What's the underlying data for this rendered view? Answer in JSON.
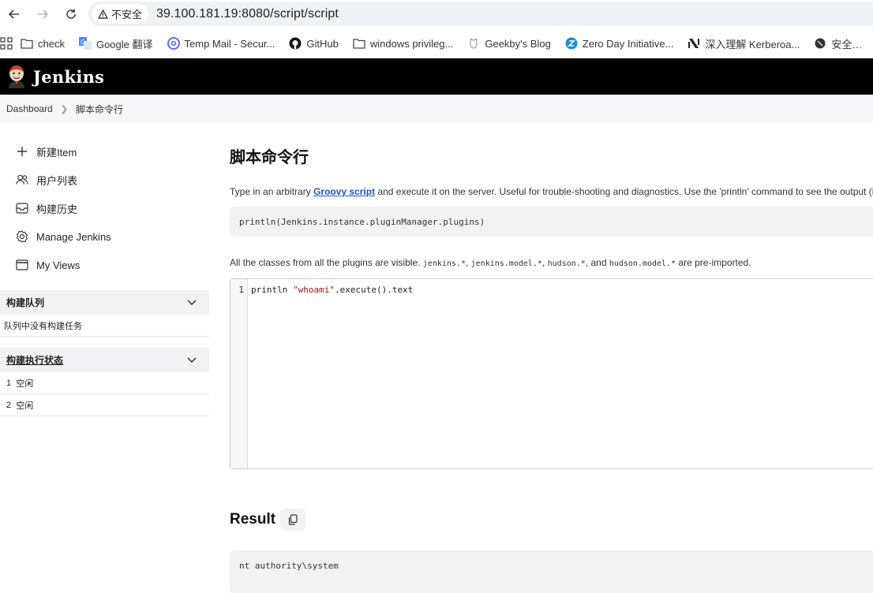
{
  "browser": {
    "security_label": "不安全",
    "url": "39.100.181.19:8080/script/script",
    "bookmarks": [
      {
        "label": "check",
        "icon": "folder-icon"
      },
      {
        "label": "Google 翻译",
        "icon": "google-translate-icon"
      },
      {
        "label": "Temp Mail - Secur...",
        "icon": "temp-mail-icon"
      },
      {
        "label": "GitHub",
        "icon": "github-icon"
      },
      {
        "label": "windows privileg...",
        "icon": "folder-icon"
      },
      {
        "label": "Geekby's Blog",
        "icon": "cat-icon"
      },
      {
        "label": "Zero Day Initiative...",
        "icon": "zdi-icon"
      },
      {
        "label": "深入理解 Kerberoa...",
        "icon": "notion-icon"
      },
      {
        "label": "安全…",
        "icon": "site-icon"
      }
    ]
  },
  "header": {
    "title": "Jenkins"
  },
  "breadcrumb": {
    "root": "Dashboard",
    "current": "脚本命令行"
  },
  "sidebar": {
    "tasks": [
      {
        "label": "新建Item",
        "icon": "plus-icon"
      },
      {
        "label": "用户列表",
        "icon": "people-icon"
      },
      {
        "label": "构建历史",
        "icon": "history-icon"
      },
      {
        "label": "Manage Jenkins",
        "icon": "gear-icon"
      },
      {
        "label": "My Views",
        "icon": "window-icon"
      }
    ],
    "queue": {
      "title": "构建队列",
      "empty": "队列中没有构建任务"
    },
    "executors": {
      "title": "构建执行状态",
      "rows": [
        {
          "num": "1",
          "status": "空闲"
        },
        {
          "num": "2",
          "status": "空闲"
        }
      ]
    }
  },
  "main": {
    "title": "脚本命令行",
    "desc_pre": "Type in an arbitrary ",
    "desc_link": "Groovy script",
    "desc_post": " and execute it on the server. Useful for trouble-shooting and diagnostics. Use the 'println' command to see the output (if yo",
    "example": "println(Jenkins.instance.pluginManager.plugins)",
    "preimport_pre": "All the classes from all the plugins are visible. ",
    "preimport_c1": "jenkins.*",
    "preimport_s1": ", ",
    "preimport_c2": "jenkins.model.*",
    "preimport_s2": ", ",
    "preimport_c3": "hudson.*",
    "preimport_s3": ", and ",
    "preimport_c4": "hudson.model.*",
    "preimport_post": " are pre-imported.",
    "editor": {
      "line_number": "1",
      "code_pre": "println ",
      "code_str": "\"whoami\"",
      "code_post": ".execute().text"
    },
    "result_title": "Result",
    "output": "nt authority\\system"
  }
}
